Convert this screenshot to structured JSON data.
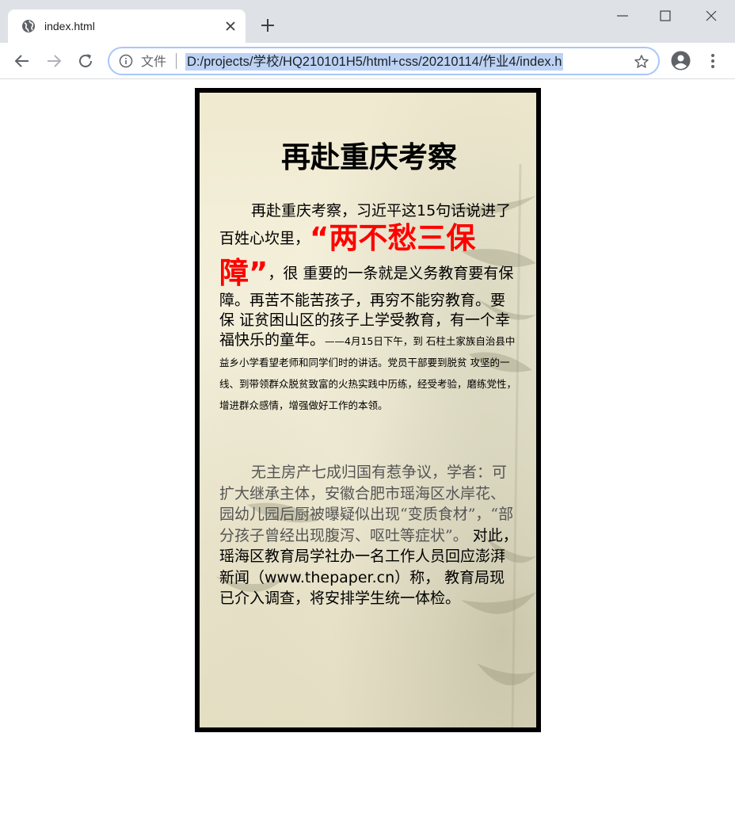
{
  "browser": {
    "tab_title": "index.html",
    "omnibox_scheme_label": "文件",
    "url": "D:/projects/学校/HQ210101H5/html+css/20210114/作业4/index.h"
  },
  "article": {
    "headline": "再赴重庆考察",
    "p1_lead": "再赴重庆考察，习近平这15句话说进了百姓心坎里，",
    "p1_highlight": "“两不愁三保障”",
    "p1_body": "，很 重要的一条就是义务教育要有保障。再苦不能苦孩子，再穷不能穷教育。要保 证贫困山区的孩子上学受教育，有一个幸福快乐的童年。",
    "p1_small": "——4月15日下午，到 石柱土家族自治县中益乡小学看望老师和同学们时的讲话。党员干部要到脱贫 攻坚的一线、到带领群众脱贫致富的火热实践中历练，经受考验，磨练党性， 增进群众感情，增强做好工作的本领。",
    "p2_serif": "无主房产七成归国有惹争议，学者：可扩大继承主体，安徽合肥市瑶海区水岸花、 园幼儿园后厨被曝疑似出现“变质食材”，“部分孩子曾经出现腹泻、呕吐等症状”。",
    "p2_body": " 对此，瑶海区教育局学社办一名工作人员回应澎湃新闻（www.thepaper.cn）称， 教育局现已介入调查，将安排学生统一体检。"
  },
  "colors": {
    "highlight": "#ff0000",
    "url_selection": "#bcd3f5",
    "card_border": "#000000"
  }
}
